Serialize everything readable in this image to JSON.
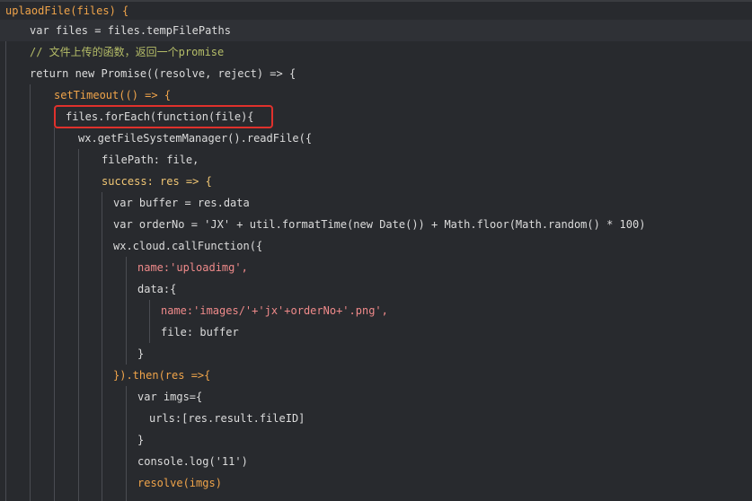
{
  "editor": {
    "lines": [
      {
        "text": "uplaodFile(files) {"
      },
      {
        "text": "var files = files.tempFilePaths"
      },
      {
        "text": "// 文件上传的函数，返回一个promise"
      },
      {
        "text": "return new Promise((resolve, reject) => {"
      },
      {
        "text": "setTimeout(() => {"
      },
      {
        "text": "files.forEach(function(file){"
      },
      {
        "text": "wx.getFileSystemManager().readFile({"
      },
      {
        "text": "filePath: file,"
      },
      {
        "text": "success: res => {"
      },
      {
        "text": "var buffer = res.data"
      },
      {
        "text": "var orderNo = 'JX' + util.formatTime(new Date()) + Math.floor(Math.random() * 100)"
      },
      {
        "text": "wx.cloud.callFunction({"
      },
      {
        "text": "name:'uploadimg',"
      },
      {
        "text": "data:{"
      },
      {
        "text": "name:'images/'+'jx'+orderNo+'.png',"
      },
      {
        "text": "file: buffer"
      },
      {
        "text": "}"
      },
      {
        "text": "}).then(res =>{"
      },
      {
        "text": "var imgs={"
      },
      {
        "text": "urls:[res.result.fileID]"
      },
      {
        "text": "}"
      },
      {
        "text": "console.log('11')"
      },
      {
        "text": "resolve(imgs)"
      }
    ]
  },
  "highlight": {
    "color": "#e0312c"
  }
}
